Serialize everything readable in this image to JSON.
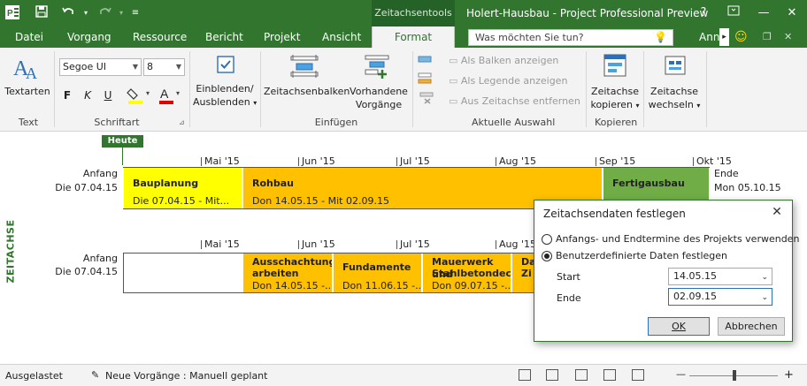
{
  "titlebar": {
    "context_tab": "Zeitachsentools",
    "app_title": "Holert-Hausbau - Project Professional Preview",
    "help": "?",
    "minimize": "—",
    "restore": "❐",
    "close": "✕"
  },
  "tabs": [
    {
      "label": "Datei"
    },
    {
      "label": "Vorgang"
    },
    {
      "label": "Ressource"
    },
    {
      "label": "Bericht"
    },
    {
      "label": "Projekt"
    },
    {
      "label": "Ansicht"
    },
    {
      "label": "Format"
    }
  ],
  "tell_me_placeholder": "Was möchten Sie tun?",
  "account_short": "Ann",
  "ribbon": {
    "text_group": {
      "button": "Textarten",
      "label": "Text"
    },
    "font_group": {
      "font": "Segoe UI",
      "size": "8",
      "bold": "F",
      "italic": "K",
      "underline": "U",
      "label": "Schriftart"
    },
    "show_hide": {
      "line1": "Einblenden/",
      "line2": "Ausblenden"
    },
    "insert_group": {
      "bars": "Zeitachsenbalken",
      "existing_line1": "Vorhandene",
      "existing_line2": "Vorgänge",
      "label": "Einfügen"
    },
    "selection_group": {
      "as_bar": "Als Balken anzeigen",
      "as_legend": "Als Legende anzeigen",
      "remove": "Aus Zeitachse entfernen",
      "label": "Aktuelle Auswahl"
    },
    "copy_group": {
      "line1": "Zeitachse",
      "line2": "kopieren",
      "label": "Kopieren"
    },
    "switch_group": {
      "line1": "Zeitachse",
      "line2": "wechseln"
    }
  },
  "timeline": {
    "side_label": "ZEITACHSE",
    "today": "Heute",
    "months": [
      "Mai '15",
      "Jun '15",
      "Jul '15",
      "Aug '15",
      "Sep '15",
      "Okt '15"
    ],
    "start_label": "Anfang",
    "start_date": "Die 07.04.15",
    "end_label": "Ende",
    "end_date": "Mon 05.10.15",
    "bars_top": [
      {
        "name": "Bauplanung",
        "dates": "Die 07.04.15 - Mit..."
      },
      {
        "name": "Rohbau",
        "dates": "Don 14.05.15 - Mit 02.09.15"
      },
      {
        "name": "Fertigausbau",
        "dates": ""
      }
    ],
    "bars_bottom": [
      {
        "name_line1": "Ausschachtungs-",
        "name_line2": "arbeiten",
        "dates": "Don 14.05.15 -..."
      },
      {
        "name_line1": "Fundamente",
        "name_line2": "",
        "dates": "Don 11.06.15 -..."
      },
      {
        "name_line1": "Mauerwerk und",
        "name_line2": "Stahlbetondecke",
        "dates": "Don 09.07.15 -..."
      },
      {
        "name_line1": "Da",
        "name_line2": "Zi",
        "dates": ""
      }
    ]
  },
  "dialog": {
    "title": "Zeitachsendaten festlegen",
    "opt1": "Anfangs- und Endtermine des Projekts verwenden",
    "opt2": "Benutzerdefinierte Daten festlegen",
    "start_label": "Start",
    "start_value": "14.05.15",
    "end_label": "Ende",
    "end_value": "02.09.15",
    "ok": "OK",
    "cancel": "Abbrechen"
  },
  "status": {
    "left": "Ausgelastet",
    "mode": "Neue Vorgänge : Manuell geplant",
    "zoom_minus": "—",
    "zoom_plus": "+"
  },
  "colors": {
    "brand_green": "#31752f",
    "bar_yellow": "#ffff00",
    "bar_orange": "#ffc000",
    "bar_green": "#70ad47"
  }
}
